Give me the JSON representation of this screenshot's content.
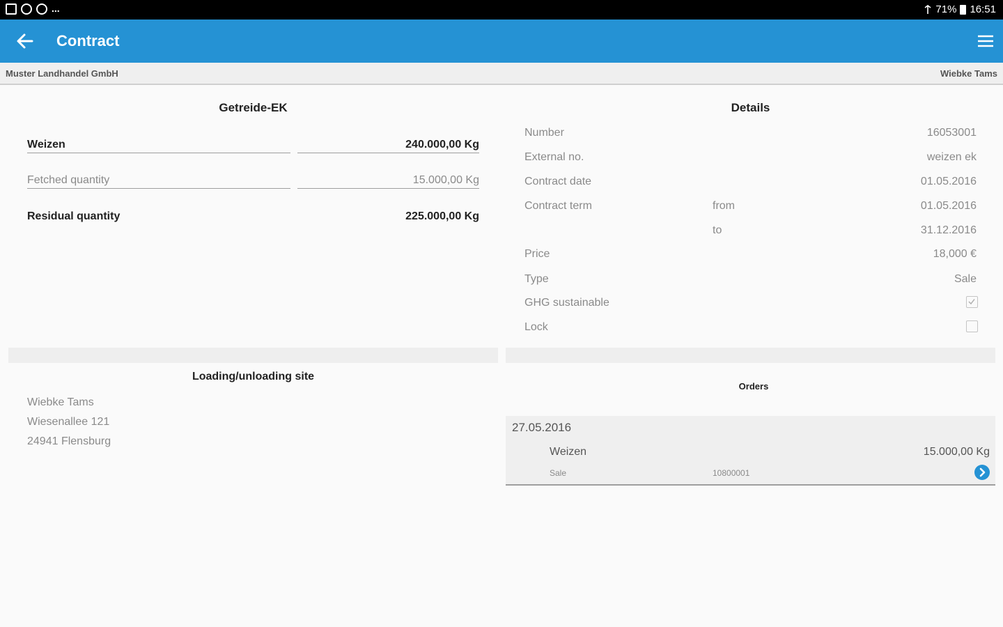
{
  "statusbar": {
    "battery": "71%",
    "time": "16:51",
    "more": "..."
  },
  "appbar": {
    "title": "Contract"
  },
  "subheader": {
    "company": "Muster Landhandel GmbH",
    "user": "Wiebke Tams"
  },
  "contract_summary": {
    "title": "Getreide-EK",
    "product_label": "Weizen",
    "product_quantity": "240.000,00 Kg",
    "fetched_label": "Fetched quantity",
    "fetched_quantity": "15.000,00 Kg",
    "residual_label": "Residual quantity",
    "residual_quantity": "225.000,00 Kg"
  },
  "details": {
    "title": "Details",
    "number_label": "Number",
    "number_value": "16053001",
    "external_label": "External no.",
    "external_value": "weizen ek",
    "date_label": "Contract date",
    "date_value": "01.05.2016",
    "term_label": "Contract term",
    "term_from_label": "from",
    "term_from_value": "01.05.2016",
    "term_to_label": "to",
    "term_to_value": "31.12.2016",
    "price_label": "Price",
    "price_value": "18,000 €",
    "type_label": "Type",
    "type_value": "Sale",
    "ghg_label": "GHG sustainable",
    "ghg_checked": true,
    "lock_label": "Lock",
    "lock_checked": false
  },
  "site": {
    "title": "Loading/unloading site",
    "name": "Wiebke Tams",
    "street": "Wiesenallee 121",
    "city": "24941 Flensburg"
  },
  "orders": {
    "title": "Orders",
    "items": [
      {
        "date": "27.05.2016",
        "product": "Weizen",
        "quantity": "15.000,00 Kg",
        "type": "Sale",
        "number": "10800001"
      }
    ]
  },
  "colors": {
    "primary": "#2592d4",
    "statusbar": "#000000"
  }
}
